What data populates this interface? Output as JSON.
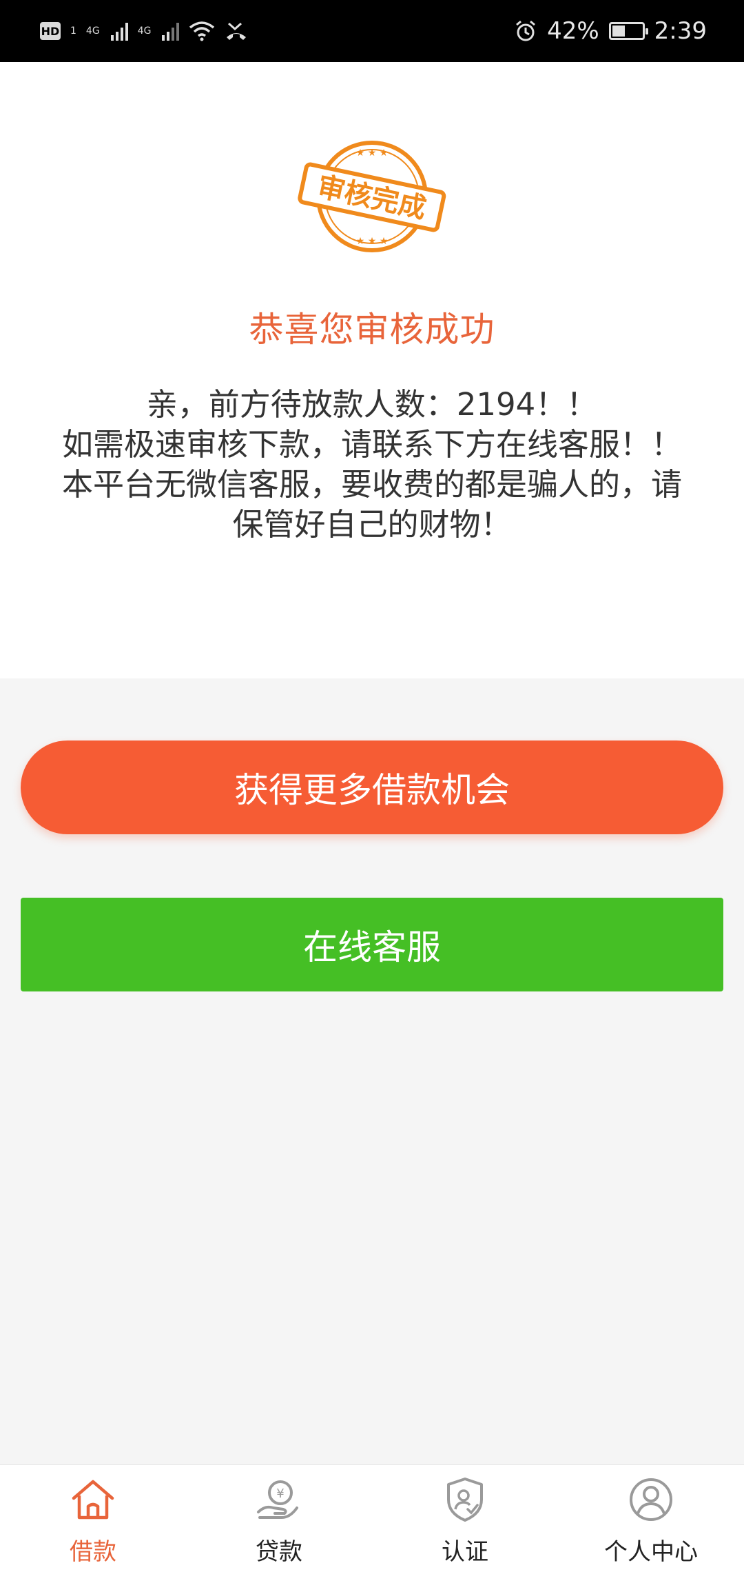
{
  "status_bar": {
    "hd": "HD",
    "hd_slot": "1",
    "net1": "4G",
    "net2": "4G",
    "battery_percent": "42%",
    "battery_level": 0.42,
    "time": "2:39"
  },
  "stamp": {
    "text": "审核完成",
    "color": "#f08a1c"
  },
  "content": {
    "title": "恭喜您审核成功",
    "lines": [
      "亲，前方待放款人数：2194！！",
      "如需极速审核下款，请联系下方在线客服！！",
      "本平台无微信客服，要收费的都是骗人的，请",
      "保管好自己的财物！"
    ]
  },
  "buttons": {
    "more_label": "获得更多借款机会",
    "service_label": "在线客服"
  },
  "nav": {
    "items": [
      {
        "label": "借款",
        "icon": "home-icon"
      },
      {
        "label": "贷款",
        "icon": "yen-hand-icon"
      },
      {
        "label": "认证",
        "icon": "shield-user-icon"
      },
      {
        "label": "个人中心",
        "icon": "user-icon"
      }
    ],
    "active_index": 0
  },
  "colors": {
    "accent": "#e8643a",
    "primary_button": "#f65c34",
    "service_button": "#45bf25",
    "nav_inactive_icon": "#9a9a9a"
  }
}
